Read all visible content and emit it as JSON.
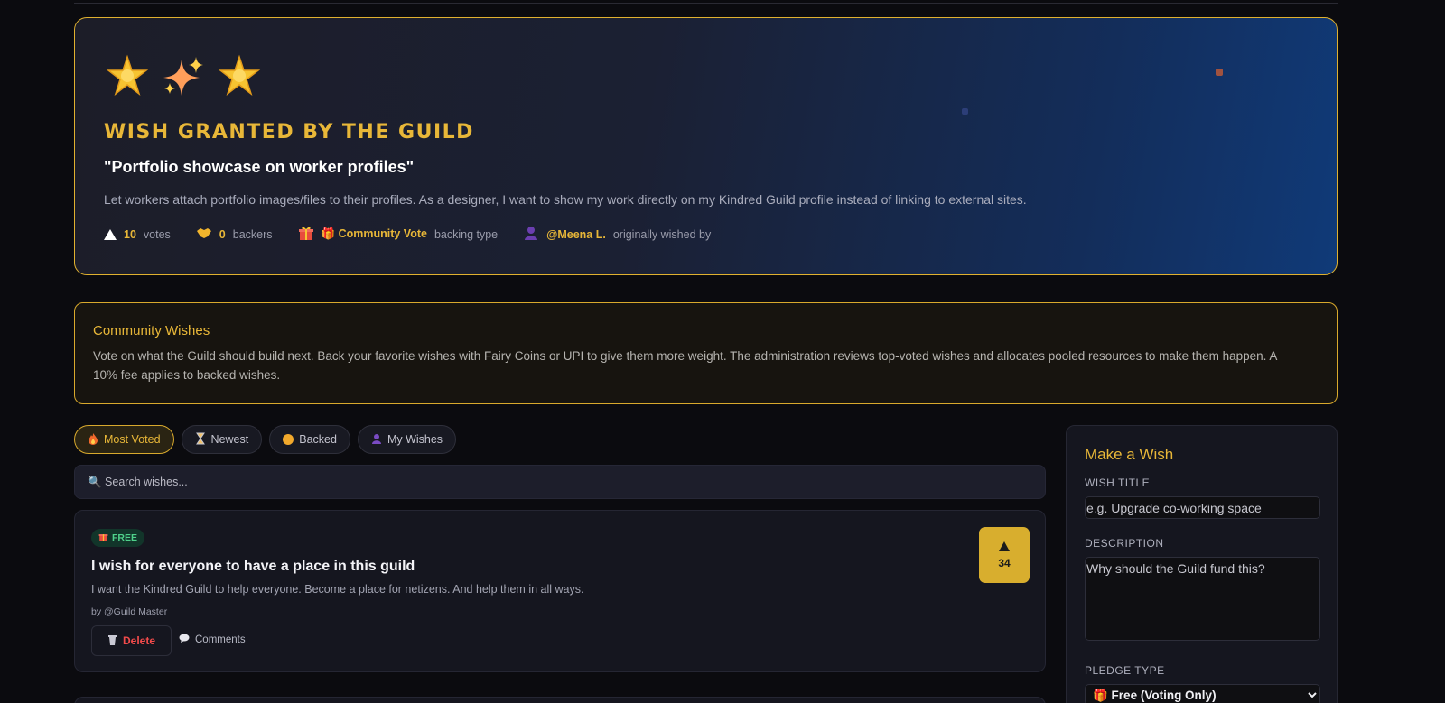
{
  "hero": {
    "icons": [
      "glowing-star-icon",
      "sparkles-icon",
      "glowing-star-icon"
    ],
    "title": "WISH GRANTED BY THE GUILD",
    "quote": "\"Portfolio showcase on worker profiles\"",
    "description": "Let workers attach portfolio images/files to their profiles. As a designer, I want to show my work directly on my Kindred Guild profile instead of linking to external sites.",
    "votes_value": "10",
    "votes_label": "votes",
    "backers_value": "0",
    "backers_label": "backers",
    "backing_value": "🎁 Community Vote",
    "backing_label": "backing type",
    "author_value": "@Meena L.",
    "author_label": "originally wished by"
  },
  "community": {
    "title": "Community Wishes",
    "text": "Vote on what the Guild should build next. Back your favorite wishes with Fairy Coins or UPI to give them more weight. The administration reviews top-voted wishes and allocates pooled resources to make them happen. A 10% fee applies to backed wishes."
  },
  "tabs": [
    {
      "label": "Most Voted",
      "active": true
    },
    {
      "label": "Newest",
      "active": false
    },
    {
      "label": "Backed",
      "active": false
    },
    {
      "label": "My Wishes",
      "active": false
    }
  ],
  "search": {
    "placeholder": "🔍 Search wishes..."
  },
  "wishes": [
    {
      "badge": "FREE",
      "title": "I wish for everyone to have a place in this guild",
      "description": "I want the Kindred Guild to help everyone. Become a place for netizens. And help them in all ways.",
      "by": "by @Guild Master",
      "delete_label": "Delete",
      "comments_label": "Comments",
      "votes": "34"
    }
  ],
  "panel": {
    "title": "Make a Wish",
    "wish_title_label": "WISH TITLE",
    "wish_title_placeholder": "e.g. Upgrade co-working space",
    "description_label": "DESCRIPTION",
    "description_placeholder": "Why should the Guild fund this?",
    "pledge_label": "PLEDGE TYPE",
    "pledge_selected": "🎁 Free (Voting Only)"
  },
  "colors": {
    "accent": "#e8b738",
    "free_badge": "#4fd18b",
    "danger": "#f24b4b"
  }
}
